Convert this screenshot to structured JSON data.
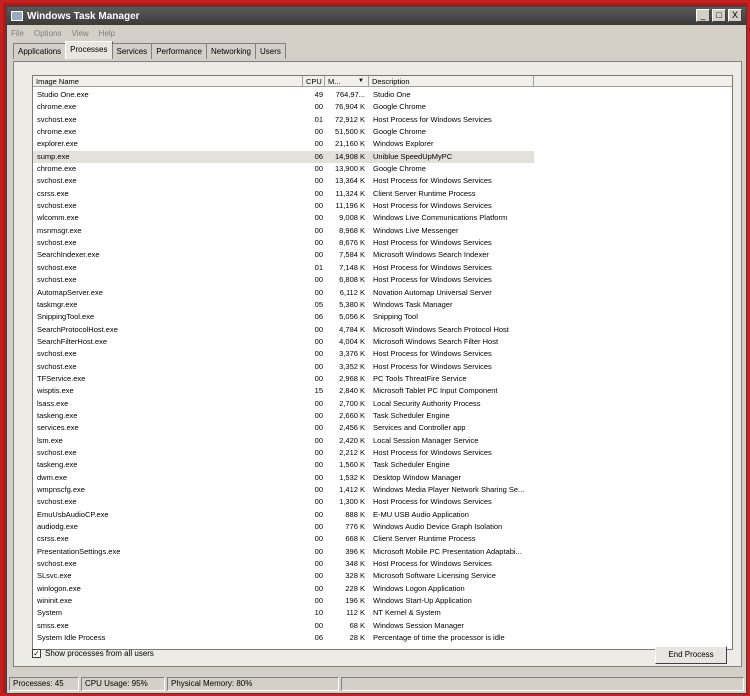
{
  "window": {
    "title": "Windows Task Manager",
    "controls": [
      "_",
      "□",
      "X"
    ]
  },
  "menu": [
    "File",
    "Options",
    "View",
    "Help"
  ],
  "tabs": [
    "Applications",
    "Processes",
    "Services",
    "Performance",
    "Networking",
    "Users"
  ],
  "active_tab": "Processes",
  "columns": {
    "name": "Image Name",
    "cpu": "CPU",
    "mem": "M...",
    "desc": "Description"
  },
  "processes": [
    [
      "Studio One.exe",
      "49",
      "764,97...",
      "Studio One"
    ],
    [
      "chrome.exe",
      "00",
      "76,904 K",
      "Google Chrome"
    ],
    [
      "svchost.exe",
      "01",
      "72,912 K",
      "Host Process for Windows Services"
    ],
    [
      "chrome.exe",
      "00",
      "51,500 K",
      "Google Chrome"
    ],
    [
      "explorer.exe",
      "00",
      "21,160 K",
      "Windows Explorer"
    ],
    [
      "sump.exe",
      "06",
      "14,908 K",
      "Uniblue SpeedUpMyPC"
    ],
    [
      "chrome.exe",
      "00",
      "13,900 K",
      "Google Chrome"
    ],
    [
      "svchost.exe",
      "00",
      "13,364 K",
      "Host Process for Windows Services"
    ],
    [
      "csrss.exe",
      "00",
      "11,324 K",
      "Client Server Runtime Process"
    ],
    [
      "svchost.exe",
      "00",
      "11,196 K",
      "Host Process for Windows Services"
    ],
    [
      "wlcomm.exe",
      "00",
      "9,008 K",
      "Windows Live Communications Platform"
    ],
    [
      "msnmsgr.exe",
      "00",
      "8,968 K",
      "Windows Live Messenger"
    ],
    [
      "svchost.exe",
      "00",
      "8,676 K",
      "Host Process for Windows Services"
    ],
    [
      "SearchIndexer.exe",
      "00",
      "7,584 K",
      "Microsoft Windows Search Indexer"
    ],
    [
      "svchost.exe",
      "01",
      "7,148 K",
      "Host Process for Windows Services"
    ],
    [
      "svchost.exe",
      "00",
      "6,808 K",
      "Host Process for Windows Services"
    ],
    [
      "AutomapServer.exe",
      "00",
      "6,112 K",
      "Novation Automap Universal Server"
    ],
    [
      "taskmgr.exe",
      "05",
      "5,380 K",
      "Windows Task Manager"
    ],
    [
      "SnippingTool.exe",
      "06",
      "5,056 K",
      "Snipping Tool"
    ],
    [
      "SearchProtocolHost.exe",
      "00",
      "4,784 K",
      "Microsoft Windows Search Protocol Host"
    ],
    [
      "SearchFilterHost.exe",
      "00",
      "4,004 K",
      "Microsoft Windows Search Filter Host"
    ],
    [
      "svchost.exe",
      "00",
      "3,376 K",
      "Host Process for Windows Services"
    ],
    [
      "svchost.exe",
      "00",
      "3,352 K",
      "Host Process for Windows Services"
    ],
    [
      "TFService.exe",
      "00",
      "2,968 K",
      "PC Tools ThreatFire Service"
    ],
    [
      "wisptis.exe",
      "15",
      "2,840 K",
      "Microsoft Tablet PC Input Component"
    ],
    [
      "lsass.exe",
      "00",
      "2,700 K",
      "Local Security Authority Process"
    ],
    [
      "taskeng.exe",
      "00",
      "2,660 K",
      "Task Scheduler Engine"
    ],
    [
      "services.exe",
      "00",
      "2,456 K",
      "Services and Controller app"
    ],
    [
      "lsm.exe",
      "00",
      "2,420 K",
      "Local Session Manager Service"
    ],
    [
      "svchost.exe",
      "00",
      "2,212 K",
      "Host Process for Windows Services"
    ],
    [
      "taskeng.exe",
      "00",
      "1,560 K",
      "Task Scheduler Engine"
    ],
    [
      "dwm.exe",
      "00",
      "1,532 K",
      "Desktop Window Manager"
    ],
    [
      "wmpnscfg.exe",
      "00",
      "1,412 K",
      "Windows Media Player Network Sharing Se..."
    ],
    [
      "svchost.exe",
      "00",
      "1,300 K",
      "Host Process for Windows Services"
    ],
    [
      "EmuUsbAudioCP.exe",
      "00",
      "888 K",
      "E-MU USB Audio Application"
    ],
    [
      "audiodg.exe",
      "00",
      "776 K",
      "Windows Audio Device Graph Isolation"
    ],
    [
      "csrss.exe",
      "00",
      "668 K",
      "Client Server Runtime Process"
    ],
    [
      "PresentationSettings.exe",
      "00",
      "396 K",
      "Microsoft Mobile PC Presentation Adaptabi..."
    ],
    [
      "svchost.exe",
      "00",
      "348 K",
      "Host Process for Windows Services"
    ],
    [
      "SLsvc.exe",
      "00",
      "328 K",
      "Microsoft Software Licensing Service"
    ],
    [
      "winlogon.exe",
      "00",
      "228 K",
      "Windows Logon Application"
    ],
    [
      "wininit.exe",
      "00",
      "196 K",
      "Windows Start-Up Application"
    ],
    [
      "System",
      "10",
      "112 K",
      "NT Kernel & System"
    ],
    [
      "smss.exe",
      "00",
      "68 K",
      "Windows Session Manager"
    ],
    [
      "System Idle Process",
      "06",
      "28 K",
      "Percentage of time the processor is idle"
    ]
  ],
  "selected_process": "sump.exe",
  "show_all_label": "Show processes from all users",
  "show_all_checked": "✓",
  "end_process_label": "End Process",
  "status": {
    "processes": "Processes: 45",
    "cpu": "CPU Usage: 95%",
    "memory": "Physical Memory: 80%"
  }
}
